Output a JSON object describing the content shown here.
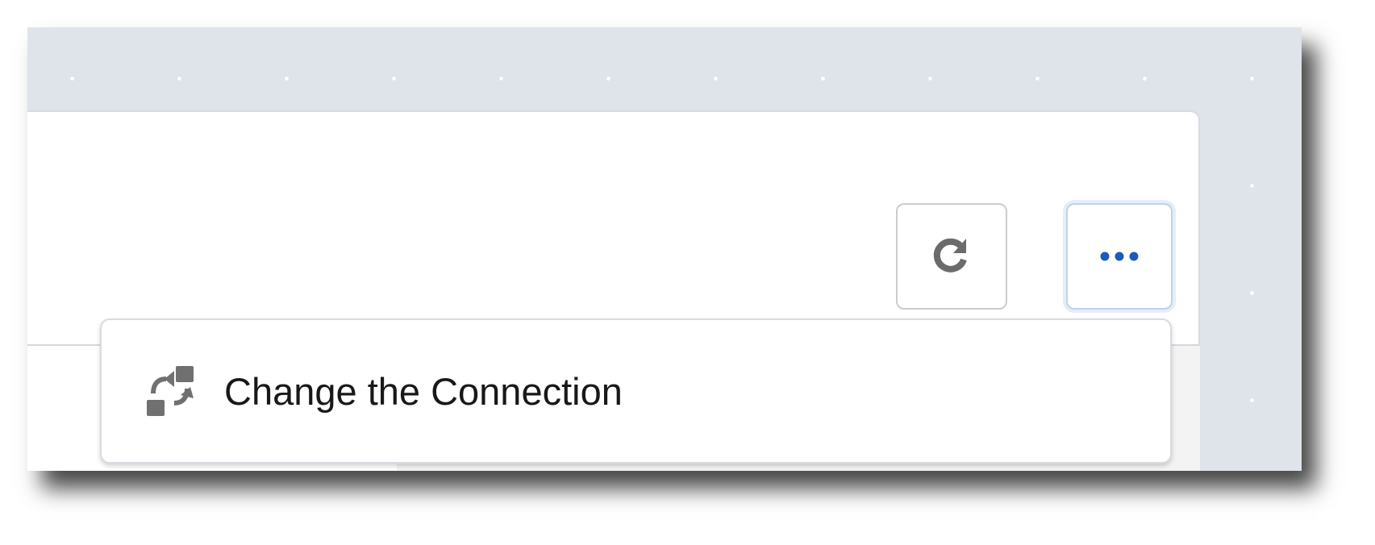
{
  "toolbar": {
    "refresh_icon": "refresh-icon",
    "more_icon": "ellipsis-icon",
    "accent_color": "#1b5cb8"
  },
  "menu": {
    "items": [
      {
        "label": "Change the Connection",
        "icon": "swap-arrows-icon"
      }
    ]
  }
}
